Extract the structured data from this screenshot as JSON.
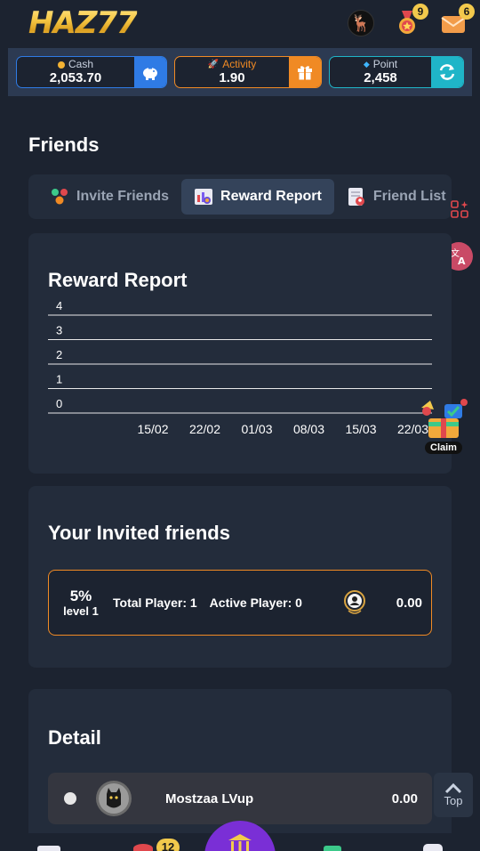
{
  "header": {
    "logo_text": "HAZ77",
    "notifications": [
      {
        "icon": "medal-icon",
        "count": "9"
      },
      {
        "icon": "mail-icon",
        "count": "6"
      }
    ]
  },
  "wallet": {
    "cash": {
      "label": "Cash",
      "value": "2,053.70",
      "button_icon": "piggy-bank-icon",
      "color": "#2f7be5"
    },
    "activity": {
      "label": "Activity",
      "value": "1.90",
      "button_icon": "gift-icon",
      "color": "#f08a24"
    },
    "point": {
      "label": "Point",
      "value": "2,458",
      "button_icon": "refresh-icon",
      "color": "#1fb5c8"
    }
  },
  "page": {
    "title": "Friends"
  },
  "tabs": [
    {
      "label": "Invite Friends",
      "icon": "invite-friends-icon",
      "active": false
    },
    {
      "label": "Reward Report",
      "icon": "reward-report-icon",
      "active": true
    },
    {
      "label": "Friend List",
      "icon": "friend-list-icon",
      "active": false
    }
  ],
  "reward_report": {
    "title": "Reward Report",
    "claim_label": "Claim"
  },
  "chart_data": {
    "type": "line",
    "title": "Reward Report",
    "categories": [
      "15/02",
      "22/02",
      "01/03",
      "08/03",
      "15/03",
      "22/03"
    ],
    "values": [
      0,
      0,
      0,
      0,
      0,
      0
    ],
    "yticks": [
      "4",
      "3",
      "2",
      "1",
      "0"
    ],
    "ylim": [
      0,
      4
    ],
    "grid": true
  },
  "invited": {
    "title": "Your Invited friends",
    "percent": "5%",
    "level": "level 1",
    "total_player": "Total Player: 1",
    "active_player": "Active Player: 0",
    "amount": "0.00"
  },
  "detail": {
    "title": "Detail",
    "rows": [
      {
        "name": "Mostzaa LVup",
        "amount": "0.00"
      }
    ]
  },
  "top_button": {
    "label": "Top"
  },
  "bottom_nav": {
    "badge": "12"
  }
}
